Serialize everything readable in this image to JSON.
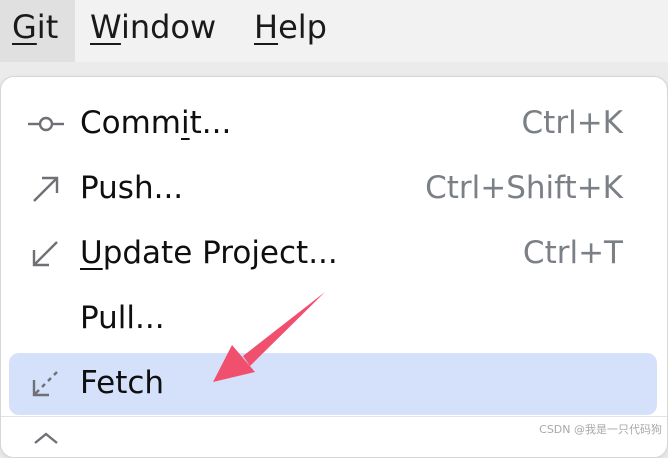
{
  "menubar": {
    "git": {
      "mnemonic": "G",
      "rest": "it"
    },
    "window": {
      "mnemonic": "W",
      "rest": "indow"
    },
    "help": {
      "mnemonic": "H",
      "rest": "elp"
    }
  },
  "menu": {
    "items": [
      {
        "label_pre": "Comm",
        "label_mn": "i",
        "label_post": "t...",
        "shortcut": "Ctrl+K",
        "icon": "commit-icon"
      },
      {
        "label_pre": "Push...",
        "label_mn": "",
        "label_post": "",
        "shortcut": "Ctrl+Shift+K",
        "icon": "push-arrow-icon"
      },
      {
        "label_pre": "",
        "label_mn": "U",
        "label_post": "pdate Project...",
        "shortcut": "Ctrl+T",
        "icon": "update-arrow-icon"
      },
      {
        "label_pre": "Pull...",
        "label_mn": "",
        "label_post": "",
        "shortcut": "",
        "icon": ""
      },
      {
        "label_pre": "Fetch",
        "label_mn": "",
        "label_post": "",
        "shortcut": "",
        "icon": "fetch-icon",
        "selected": true
      }
    ]
  },
  "colors": {
    "selection": "#d5e1fb",
    "annotation_arrow": "#f0506e",
    "shortcut_text": "#7b7f86"
  },
  "watermark": "CSDN @我是一只代码狗"
}
